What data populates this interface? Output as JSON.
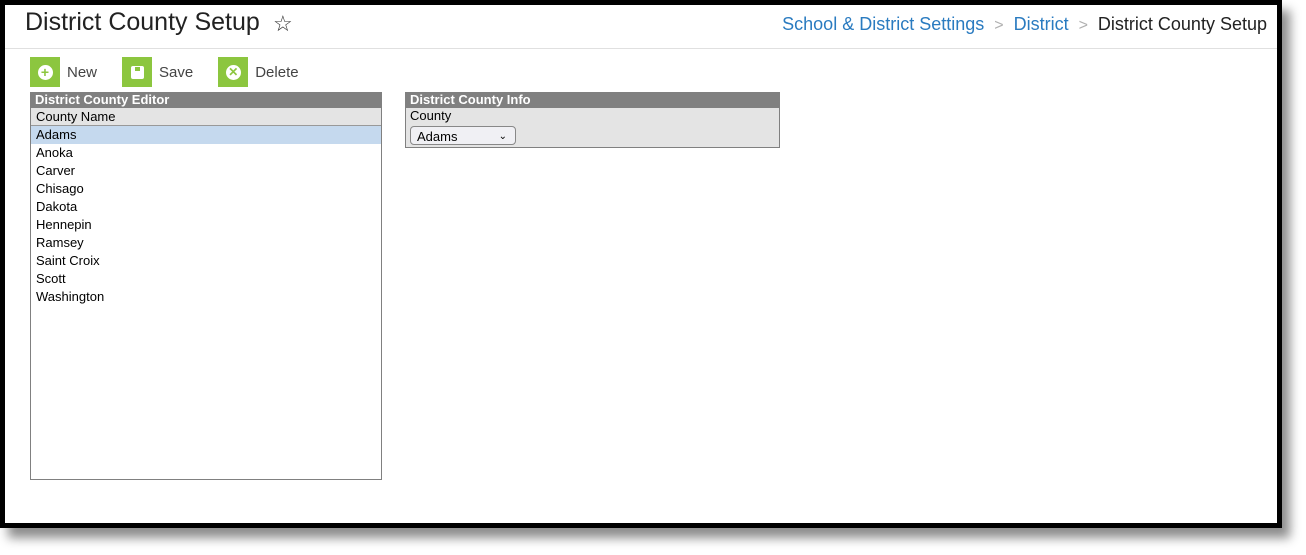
{
  "header": {
    "title": "District County Setup",
    "breadcrumb": [
      "School & District Settings",
      "District",
      "District County Setup"
    ]
  },
  "toolbar": {
    "new_label": "New",
    "save_label": "Save",
    "delete_label": "Delete"
  },
  "editor": {
    "title": "District County Editor",
    "column_header": "County Name",
    "selected_index": 0,
    "rows": [
      "Adams",
      "Anoka",
      "Carver",
      "Chisago",
      "Dakota",
      "Hennepin",
      "Ramsey",
      "Saint Croix",
      "Scott",
      "Washington"
    ]
  },
  "info": {
    "title": "District County Info",
    "county_label": "County",
    "county_value": "Adams"
  },
  "colors": {
    "accent_green": "#8cc63f",
    "link_blue": "#2a7bc0",
    "panel_header": "#808080",
    "selected_row": "#c5d9ee"
  }
}
